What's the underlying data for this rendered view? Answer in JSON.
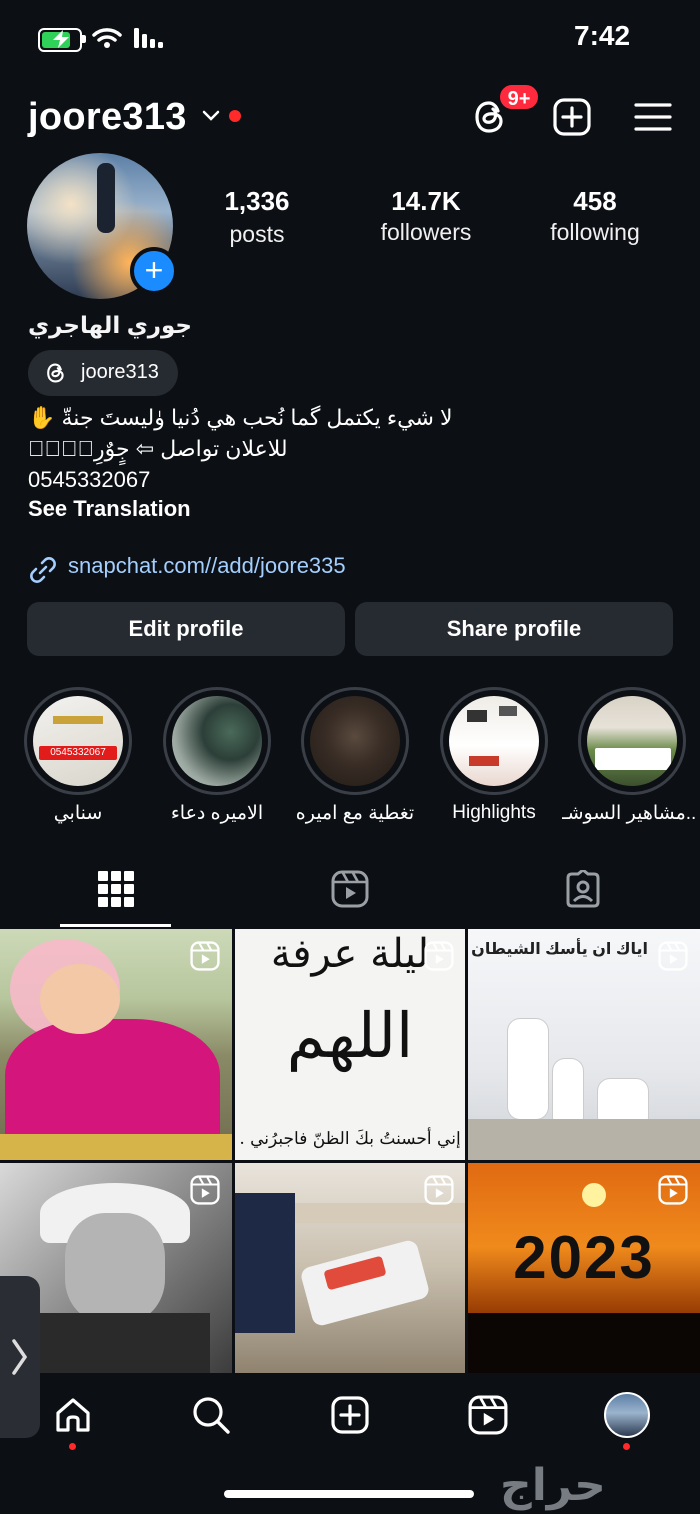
{
  "status_bar": {
    "time": "7:42"
  },
  "header": {
    "username": "joore313",
    "notification_badge": "9+"
  },
  "stats": {
    "posts": {
      "value": "1,336",
      "label": "posts"
    },
    "followers": {
      "value": "14.7K",
      "label": "followers"
    },
    "following": {
      "value": "458",
      "label": "following"
    }
  },
  "profile": {
    "full_name": "جوري الهاجري",
    "threads_handle": "joore313",
    "bio_lines": [
      "لا شيء يكتمل گما نُحب هي دُنيا وٰليستَ جنةّ ✋",
      "للاعلان تواصل ⇦ جٍوٌرِيّ۪ٜ",
      "0545332067"
    ],
    "see_translation": "See Translation",
    "link": "snapchat.com//add/joore335"
  },
  "buttons": {
    "edit": "Edit profile",
    "share": "Share profile"
  },
  "highlights": [
    {
      "label": "سنابي"
    },
    {
      "label": "الاميره دعاء"
    },
    {
      "label": "تغطية مع اميره"
    },
    {
      "label": "Highlights"
    },
    {
      "label": "مشاهير السوشـ..."
    }
  ],
  "posts_text": {
    "post2_title": "ليلة عرفة",
    "post2_main": "اللهم",
    "post2_bottom": "إني أحسنتُ بكَ الظنّ فاجبرُني .",
    "post3_caption": "اياك ان يأسك الشيطان",
    "post6_year": "2023",
    "highlight1_phone": "0545332067"
  },
  "watermark": "حراج"
}
